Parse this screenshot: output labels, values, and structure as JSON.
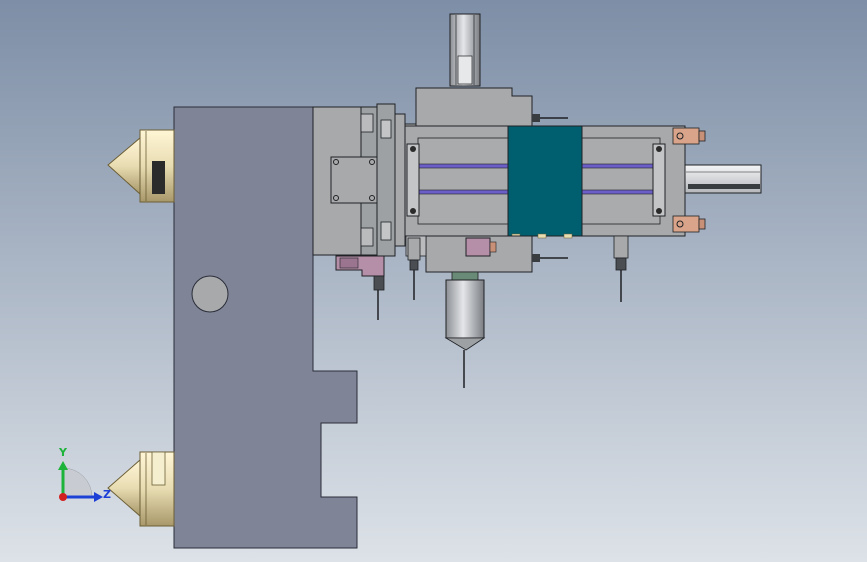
{
  "viewport": {
    "background_top": "#7d8ea6",
    "background_bottom": "#dde2e8"
  },
  "colors": {
    "plate": "#7f8497",
    "plate_edge": "#2a2d38",
    "body": "#a7a9ab",
    "body_dark": "#8e9194",
    "edge": "#1f2124",
    "carriage": "#005f6e",
    "rail": "#6b5fc7",
    "brass": "#e8dcb2",
    "brass_dark": "#9a8a55",
    "copper": "#d9a48a",
    "magenta": "#b58fa8",
    "white_part": "#eef0f2"
  },
  "triad": {
    "y_label": "Y",
    "z_label": "Z",
    "y_color": "#1db33a",
    "z_color": "#1c3fd6",
    "x_color": "#d21f1f"
  }
}
